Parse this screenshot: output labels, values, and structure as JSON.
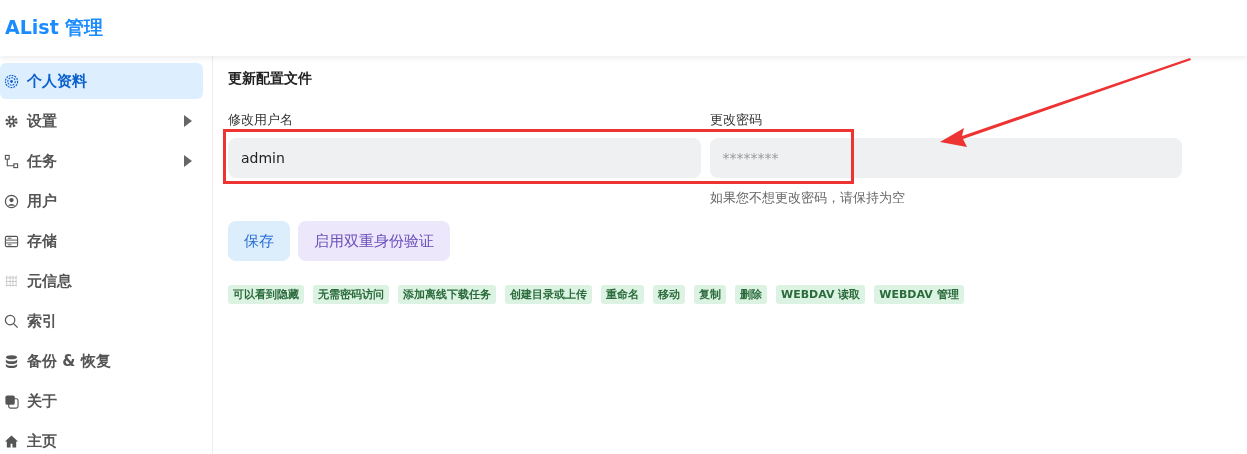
{
  "header": {
    "title": "AList 管理"
  },
  "sidebar": {
    "items": [
      {
        "label": "个人资料",
        "kind": "link",
        "selected": true
      },
      {
        "label": "设置",
        "kind": "group",
        "selected": false
      },
      {
        "label": "任务",
        "kind": "group",
        "selected": false
      },
      {
        "label": "用户",
        "kind": "link",
        "selected": false
      },
      {
        "label": "存储",
        "kind": "link",
        "selected": false
      },
      {
        "label": "元信息",
        "kind": "link",
        "selected": false
      },
      {
        "label": "索引",
        "kind": "link",
        "selected": false
      },
      {
        "label": "备份 & 恢复",
        "kind": "link",
        "selected": false
      },
      {
        "label": "关于",
        "kind": "link",
        "selected": false
      },
      {
        "label": "主页",
        "kind": "link",
        "selected": false
      }
    ]
  },
  "content": {
    "heading": "更新配置文件",
    "fields": [
      {
        "label": "修改用户名",
        "value": "admin"
      },
      {
        "label": "更改密码",
        "placeholder": "********",
        "hint": "如果您不想更改密码，请保持为空"
      }
    ],
    "buttons": [
      {
        "label": "保存",
        "kind": "primary"
      },
      {
        "label": "启用双重身份验证",
        "kind": "secondary"
      }
    ],
    "permissions": [
      "可以看到隐藏",
      "无需密码访问",
      "添加离线下载任务",
      "创建目录或上传",
      "重命名",
      "移动",
      "复制",
      "删除",
      "WEBDAV 读取",
      "WEBDAV 管理"
    ]
  }
}
